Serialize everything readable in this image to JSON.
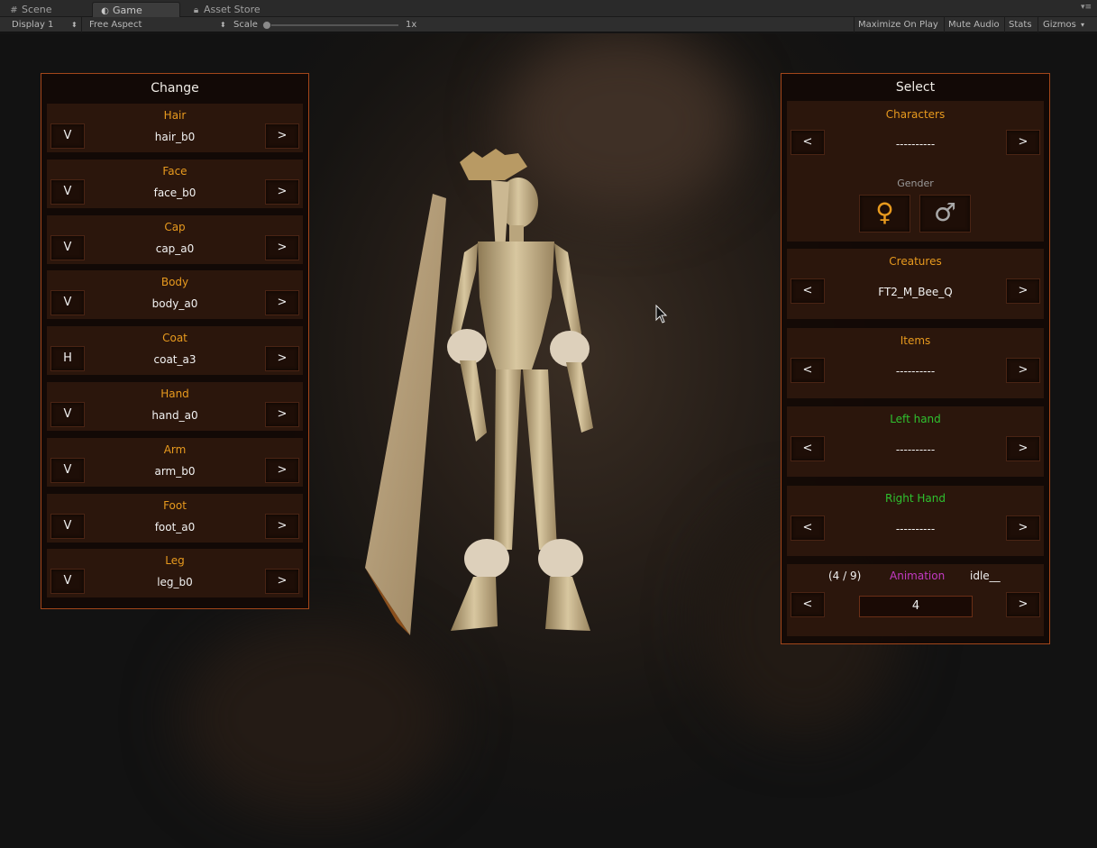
{
  "tabs": [
    {
      "label": "Scene",
      "icon": "scene-grid-icon"
    },
    {
      "label": "Game",
      "icon": "pacman-icon"
    },
    {
      "label": "Asset Store",
      "icon": "lock-icon"
    }
  ],
  "toolbar": {
    "display": "Display 1",
    "aspect": "Free Aspect",
    "scale_label": "Scale",
    "scale_value": "1x",
    "maximize": "Maximize On Play",
    "mute": "Mute Audio",
    "stats": "Stats",
    "gizmos": "Gizmos"
  },
  "change_panel": {
    "title": "Change",
    "rows": [
      {
        "label": "Hair",
        "value": "hair_b0",
        "left": "V",
        "right": ">"
      },
      {
        "label": "Face",
        "value": "face_b0",
        "left": "V",
        "right": ">"
      },
      {
        "label": "Cap",
        "value": "cap_a0",
        "left": "V",
        "right": ">"
      },
      {
        "label": "Body",
        "value": "body_a0",
        "left": "V",
        "right": ">"
      },
      {
        "label": "Coat",
        "value": "coat_a3",
        "left": "H",
        "right": ">"
      },
      {
        "label": "Hand",
        "value": "hand_a0",
        "left": "V",
        "right": ">"
      },
      {
        "label": "Arm",
        "value": "arm_b0",
        "left": "V",
        "right": ">"
      },
      {
        "label": "Foot",
        "value": "foot_a0",
        "left": "V",
        "right": ">"
      },
      {
        "label": "Leg",
        "value": "leg_b0",
        "left": "V",
        "right": ">"
      }
    ]
  },
  "select_panel": {
    "title": "Select",
    "characters": {
      "label": "Characters",
      "value": "----------",
      "prev": "<",
      "next": ">"
    },
    "gender": {
      "label": "Gender",
      "female_symbol": "♀",
      "male_symbol": "♂"
    },
    "creatures": {
      "label": "Creatures",
      "value": "FT2_M_Bee_Q",
      "prev": "<",
      "next": ">"
    },
    "items": {
      "label": "Items",
      "value": "----------",
      "prev": "<",
      "next": ">"
    },
    "left_hand": {
      "label": "Left hand",
      "value": "----------",
      "prev": "<",
      "next": ">"
    },
    "right_hand": {
      "label": "Right Hand",
      "value": "----------",
      "prev": "<",
      "next": ">"
    },
    "animation": {
      "counter": "(4 / 9)",
      "label": "Animation",
      "name": "idle__",
      "value": "4",
      "prev": "<",
      "next": ">"
    }
  },
  "colors": {
    "accent_orange": "#e89a1e",
    "green_label": "#2fc12f",
    "magenta_label": "#c33ac3",
    "panel_border": "#a3461a"
  }
}
